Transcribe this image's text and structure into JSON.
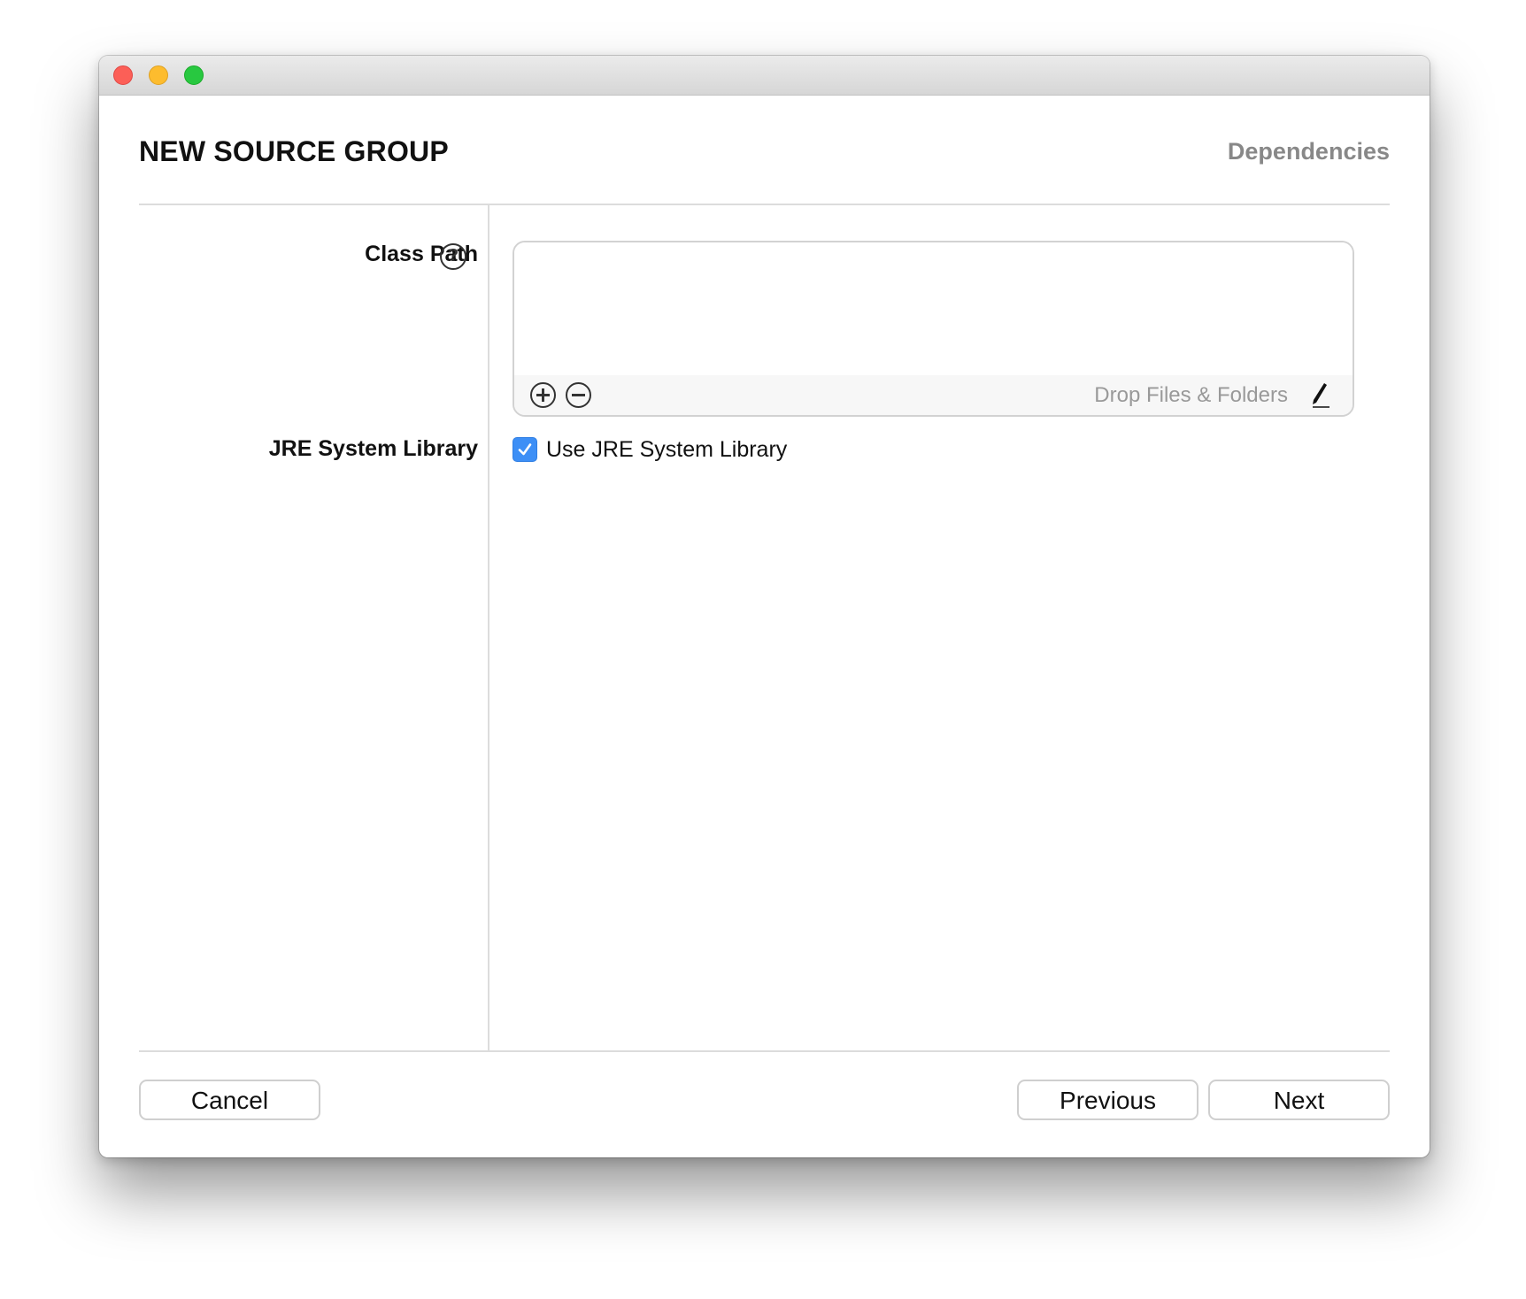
{
  "window": {
    "traffic_lights": [
      "close",
      "minimize",
      "zoom"
    ]
  },
  "header": {
    "title": "NEW SOURCE GROUP",
    "step": "Dependencies"
  },
  "form": {
    "class_path": {
      "label": "Class Path",
      "help_icon": "question-circle-icon",
      "items": [],
      "drop_hint": "Drop Files & Folders",
      "add_icon": "plus-circle-icon",
      "remove_icon": "minus-circle-icon",
      "edit_icon": "pencil-icon"
    },
    "jre_system_library": {
      "label": "JRE System Library",
      "checkbox_label": "Use JRE System Library",
      "checked": true
    }
  },
  "footer": {
    "cancel_label": "Cancel",
    "previous_label": "Previous",
    "next_label": "Next"
  },
  "colors": {
    "checkbox_accent": "#3d8ff6",
    "close": "#fc5f57",
    "minimize": "#fdbc2e",
    "zoom": "#28c840"
  }
}
